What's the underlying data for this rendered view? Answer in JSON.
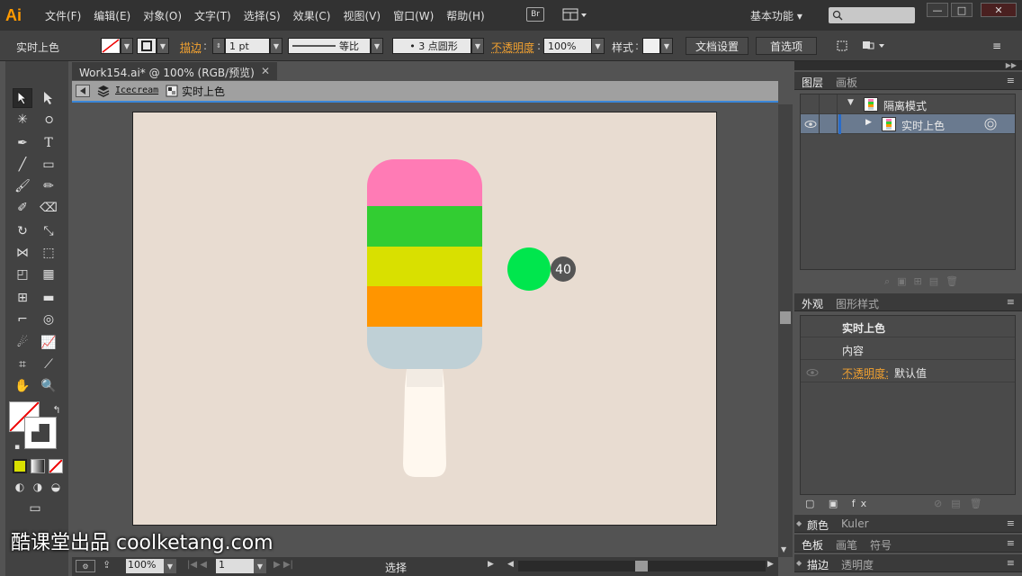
{
  "app": {
    "logo": "Ai"
  },
  "menu": [
    "文件(F)",
    "编辑(E)",
    "对象(O)",
    "文字(T)",
    "选择(S)",
    "效果(C)",
    "视图(V)",
    "窗口(W)",
    "帮助(H)"
  ],
  "topbar": {
    "bridge_label": "Br",
    "workspace": "基本功能",
    "workspace_arrow": "▾",
    "search_placeholder": ""
  },
  "window_buttons": [
    "—",
    "□",
    "✕"
  ],
  "control": {
    "object_name": "实时上色",
    "stroke_label": "描边",
    "stroke_value": "1 pt",
    "profile_label": "等比",
    "brush_label": "• 3 点圆形",
    "opacity_label": "不透明度",
    "opacity_value": "100%",
    "style_label": "样式",
    "doc_setup_button": "文档设置",
    "prefs_button": "首选项"
  },
  "document": {
    "tab_title": "Work154.ai* @ 100% (RGB/预览)",
    "tab_close": "✕",
    "breadcrumb_layer": "Icecream",
    "breadcrumb_group": "实时上色"
  },
  "artwork": {
    "stripe_colors": [
      "#ff7bb5",
      "#32cd32",
      "#d9e000",
      "#ff9500",
      "#bfd0d6"
    ],
    "stick_color": "#fff8ef",
    "marker_color": "#00e64d",
    "marker_count": "40"
  },
  "status": {
    "zoom": "100%",
    "page": "1",
    "tool": "选择"
  },
  "layers_panel": {
    "tabs": [
      "图层",
      "画板"
    ],
    "rows": [
      {
        "name": "隔离模式"
      },
      {
        "name": "实时上色"
      }
    ]
  },
  "appearance_panel": {
    "tabs": [
      "外观",
      "图形样式"
    ],
    "title": "实时上色",
    "content_label": "内容",
    "opacity_label": "不透明度:",
    "opacity_value": "默认值"
  },
  "collapsed_panels": [
    {
      "tabs": [
        "颜色",
        "Kuler"
      ]
    },
    {
      "tabs": [
        "色板",
        "画笔",
        "符号"
      ]
    },
    {
      "tabs": [
        "描边",
        "透明度"
      ]
    }
  ],
  "watermark": "酷课堂出品 coolketang.com"
}
